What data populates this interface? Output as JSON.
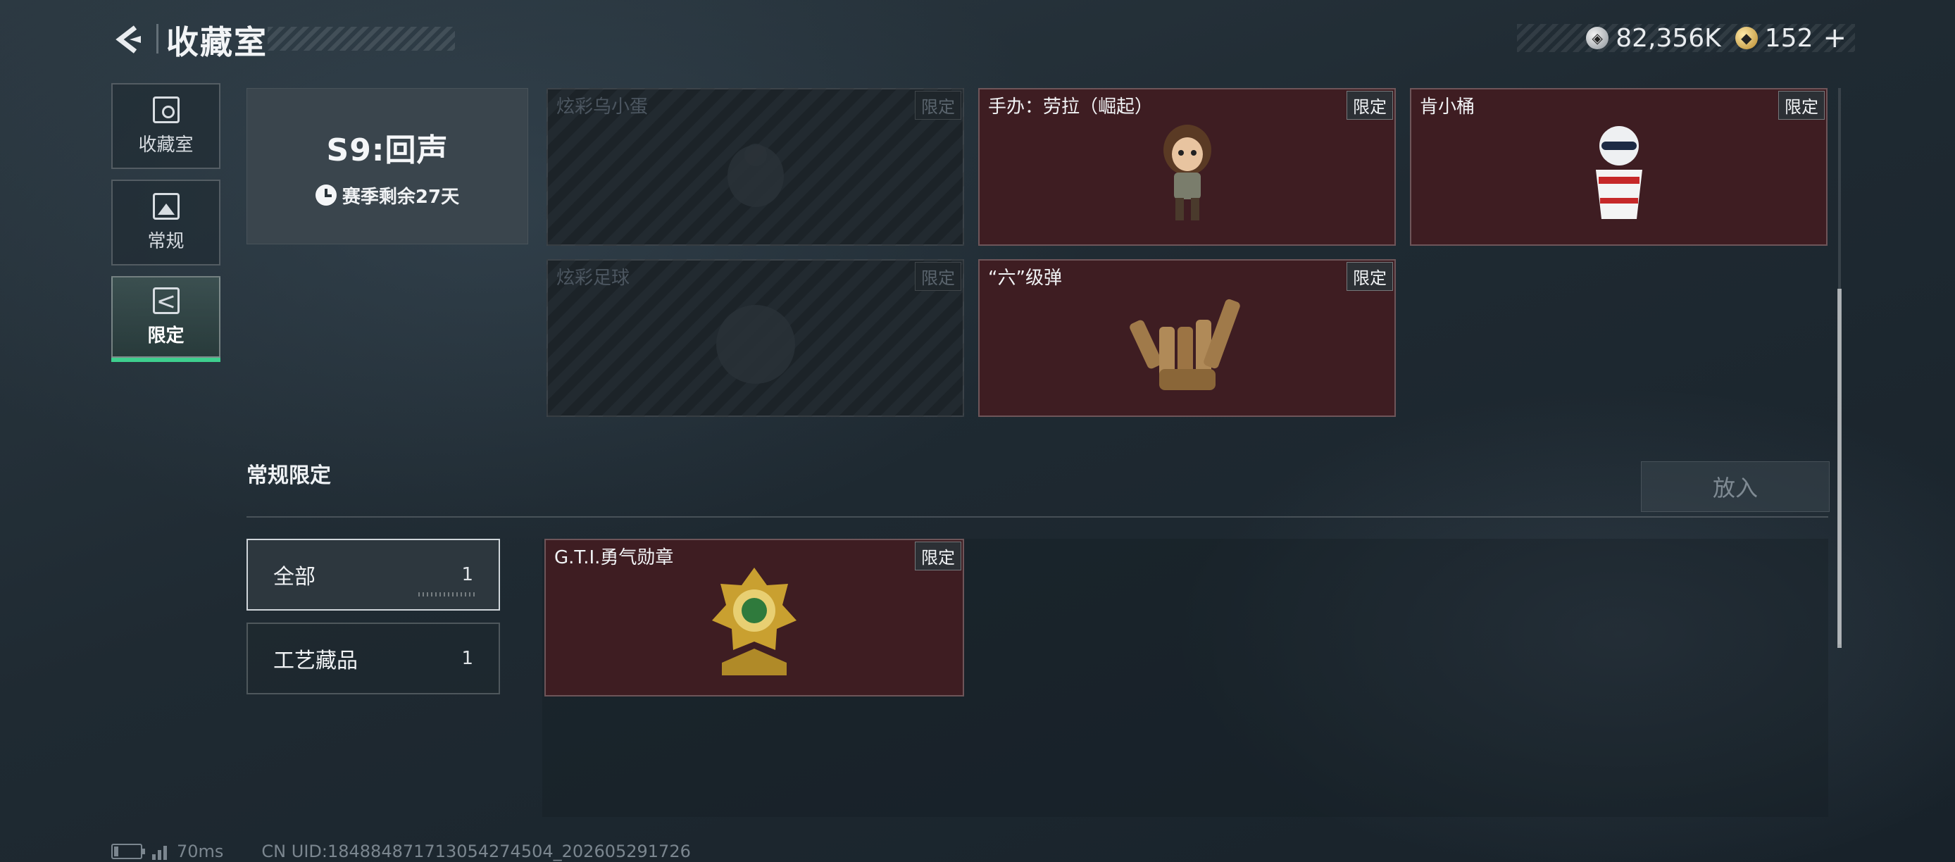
{
  "header": {
    "title": "收藏室",
    "currency": [
      {
        "name": "silver-coin-icon",
        "value": "82,356K"
      },
      {
        "name": "gold-coin-icon",
        "value": "152"
      }
    ],
    "plus_label": "+"
  },
  "nav": [
    {
      "label": "收藏室",
      "icon": "vault-icon",
      "active": false
    },
    {
      "label": "常规",
      "icon": "image-icon",
      "active": false
    },
    {
      "label": "限定",
      "icon": "limited-icon",
      "active": true
    }
  ],
  "season": {
    "title": "S9:回声",
    "remaining": "赛季剩余27天"
  },
  "season_items": [
    {
      "name": "炫彩乌小蛋",
      "tag": "限定",
      "owned": false
    },
    {
      "name": "手办：劳拉（崛起）",
      "tag": "限定",
      "owned": true
    },
    {
      "name": "肯小桶",
      "tag": "限定",
      "owned": true
    },
    {
      "name": "炫彩足球",
      "tag": "限定",
      "owned": false
    },
    {
      "name": "“六”级弹",
      "tag": "限定",
      "owned": true
    }
  ],
  "section": {
    "title": "常规限定",
    "put_in_label": "放入"
  },
  "filters": [
    {
      "name": "全部",
      "count": "1",
      "active": true
    },
    {
      "name": "工艺藏品",
      "count": "1",
      "active": false
    }
  ],
  "regular_items": [
    {
      "name": "G.T.I.勇气勋章",
      "tag": "限定",
      "owned": true
    }
  ],
  "footer": {
    "ping": "70ms",
    "uid": "CN UID:184884871713054274504_202605291726"
  },
  "colors": {
    "owned_card": "#3e1d22",
    "accent": "#3ecf8e",
    "background": "#1f2a32"
  }
}
